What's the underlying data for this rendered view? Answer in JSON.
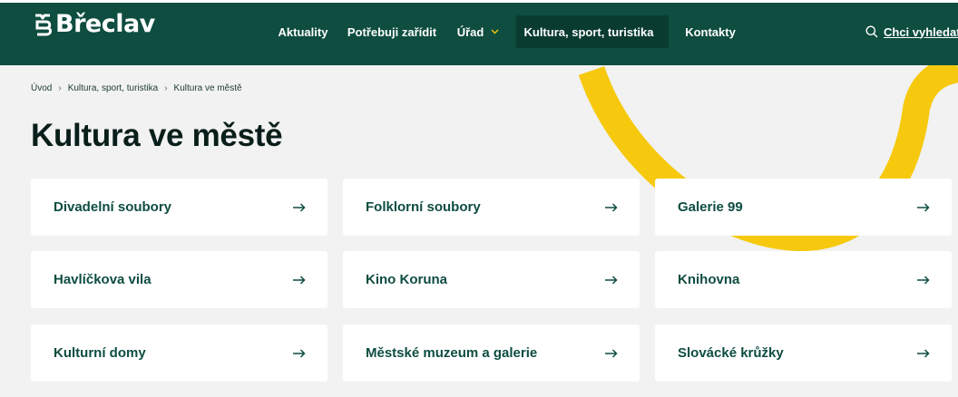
{
  "header": {
    "logo_text": "Břeclav",
    "nav": [
      {
        "label": "Aktuality",
        "dropdown": false,
        "active": false
      },
      {
        "label": "Potřebuji zařídit",
        "dropdown": false,
        "active": false
      },
      {
        "label": "Úřad",
        "dropdown": true,
        "active": false
      },
      {
        "label": "Kultura, sport, turistika",
        "dropdown": true,
        "active": true
      },
      {
        "label": "Kontakty",
        "dropdown": false,
        "active": false
      }
    ],
    "search_label": "Chci vyhledat",
    "colors": {
      "background": "#0e4d40",
      "active_item": "#0a3b31",
      "accent": "#f4c20d"
    }
  },
  "breadcrumb": {
    "items": [
      "Úvod",
      "Kultura, sport, turistika",
      "Kultura ve městě"
    ]
  },
  "page_title": "Kultura ve městě",
  "cards": [
    {
      "label": "Divadelní soubory"
    },
    {
      "label": "Folklorní soubory"
    },
    {
      "label": "Galerie 99"
    },
    {
      "label": "Havlíčkova vila"
    },
    {
      "label": "Kino Koruna"
    },
    {
      "label": "Knihovna"
    },
    {
      "label": "Kulturní domy"
    },
    {
      "label": "Městské muzeum a galerie"
    },
    {
      "label": "Slovácké krůžky"
    }
  ],
  "icons": {
    "card_arrow": "arrow-right-icon",
    "search": "search-icon",
    "dropdown": "chevron-down-icon"
  }
}
